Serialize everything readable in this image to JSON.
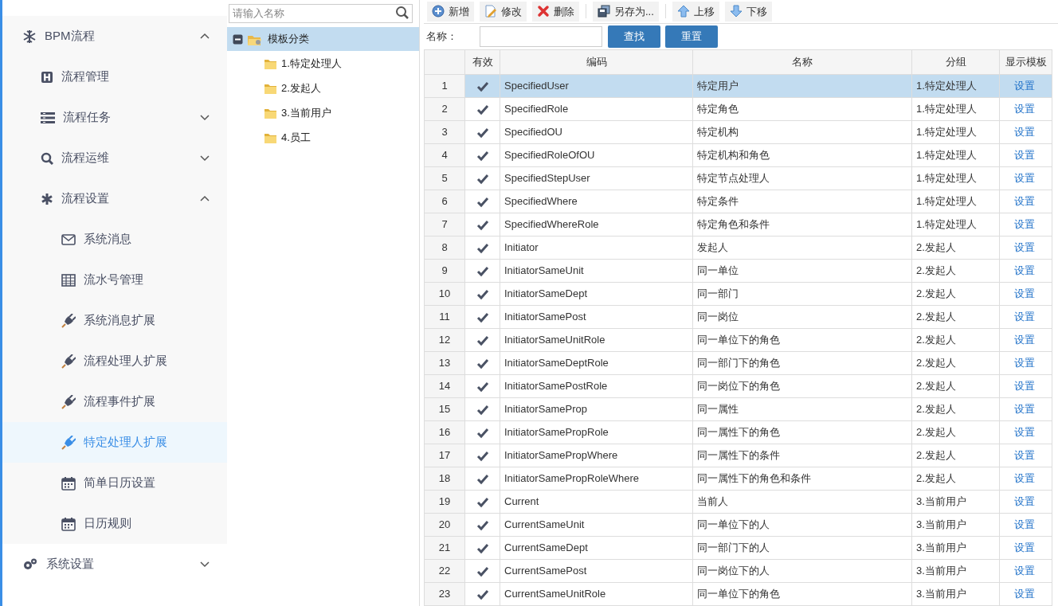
{
  "sidebar": {
    "items": [
      {
        "label": "BPM流程",
        "kind": "snowflake",
        "expanded": true,
        "children": [
          {
            "label": "流程管理",
            "kind": "h-square",
            "selected": false
          },
          {
            "label": "流程任务",
            "kind": "list",
            "expanded": false,
            "selected": false
          },
          {
            "label": "流程运维",
            "kind": "search",
            "expanded": false,
            "selected": false
          },
          {
            "label": "流程设置",
            "kind": "asterisk",
            "expanded": true,
            "selected": false,
            "children": [
              {
                "label": "系统消息",
                "kind": "envelope",
                "selected": false
              },
              {
                "label": "流水号管理",
                "kind": "table",
                "selected": false
              },
              {
                "label": "系统消息扩展",
                "kind": "plug",
                "selected": false
              },
              {
                "label": "流程处理人扩展",
                "kind": "plug",
                "selected": false
              },
              {
                "label": "流程事件扩展",
                "kind": "plug",
                "selected": false
              },
              {
                "label": "特定处理人扩展",
                "kind": "plug",
                "selected": true
              },
              {
                "label": "简单日历设置",
                "kind": "calendar",
                "selected": false
              },
              {
                "label": "日历规则",
                "kind": "calendar",
                "selected": false
              }
            ]
          }
        ]
      },
      {
        "label": "系统设置",
        "kind": "cogs",
        "expanded": false
      }
    ]
  },
  "tree": {
    "search": {
      "placeholder": "请输入名称"
    },
    "root": {
      "label": "模板分类",
      "expanded": true,
      "selected": true,
      "children": [
        {
          "label": "1.特定处理人",
          "selected": false
        },
        {
          "label": "2.发起人",
          "selected": false
        },
        {
          "label": "3.当前用户",
          "selected": false
        },
        {
          "label": "4.员工",
          "selected": false
        }
      ]
    }
  },
  "toolbar": [
    {
      "label": "新增",
      "kind": "add"
    },
    {
      "label": "修改",
      "kind": "edit"
    },
    {
      "label": "删除",
      "kind": "delete"
    },
    {
      "label": "另存为...",
      "kind": "saveas"
    },
    {
      "label": "上移",
      "kind": "up"
    },
    {
      "label": "下移",
      "kind": "down"
    }
  ],
  "filter": {
    "label": "名称：",
    "buttons": [
      "查找",
      "重置"
    ]
  },
  "table": {
    "columns": [
      "有效",
      "编码",
      "名称",
      "分组",
      "显示模板"
    ],
    "rows": [
      {
        "index": "1",
        "valid": true,
        "code": "SpecifiedUser",
        "name": "特定用户",
        "group": "1.特定处理人",
        "link": "设置",
        "selected": true
      },
      {
        "index": "2",
        "valid": true,
        "code": "SpecifiedRole",
        "name": "特定角色",
        "group": "1.特定处理人",
        "link": "设置",
        "selected": false
      },
      {
        "index": "3",
        "valid": true,
        "code": "SpecifiedOU",
        "name": "特定机构",
        "group": "1.特定处理人",
        "link": "设置",
        "selected": false
      },
      {
        "index": "4",
        "valid": true,
        "code": "SpecifiedRoleOfOU",
        "name": "特定机构和角色",
        "group": "1.特定处理人",
        "link": "设置",
        "selected": false
      },
      {
        "index": "5",
        "valid": true,
        "code": "SpecifiedStepUser",
        "name": "特定节点处理人",
        "group": "1.特定处理人",
        "link": "设置",
        "selected": false
      },
      {
        "index": "6",
        "valid": true,
        "code": "SpecifiedWhere",
        "name": "特定条件",
        "group": "1.特定处理人",
        "link": "设置",
        "selected": false
      },
      {
        "index": "7",
        "valid": true,
        "code": "SpecifiedWhereRole",
        "name": "特定角色和条件",
        "group": "1.特定处理人",
        "link": "设置",
        "selected": false
      },
      {
        "index": "8",
        "valid": true,
        "code": "Initiator",
        "name": "发起人",
        "group": "2.发起人",
        "link": "设置",
        "selected": false
      },
      {
        "index": "9",
        "valid": true,
        "code": "InitiatorSameUnit",
        "name": "同一单位",
        "group": "2.发起人",
        "link": "设置",
        "selected": false
      },
      {
        "index": "10",
        "valid": true,
        "code": "InitiatorSameDept",
        "name": "同一部门",
        "group": "2.发起人",
        "link": "设置",
        "selected": false
      },
      {
        "index": "11",
        "valid": true,
        "code": "InitiatorSamePost",
        "name": "同一岗位",
        "group": "2.发起人",
        "link": "设置",
        "selected": false
      },
      {
        "index": "12",
        "valid": true,
        "code": "InitiatorSameUnitRole",
        "name": "同一单位下的角色",
        "group": "2.发起人",
        "link": "设置",
        "selected": false
      },
      {
        "index": "13",
        "valid": true,
        "code": "InitiatorSameDeptRole",
        "name": "同一部门下的角色",
        "group": "2.发起人",
        "link": "设置",
        "selected": false
      },
      {
        "index": "14",
        "valid": true,
        "code": "InitiatorSamePostRole",
        "name": "同一岗位下的角色",
        "group": "2.发起人",
        "link": "设置",
        "selected": false
      },
      {
        "index": "15",
        "valid": true,
        "code": "InitiatorSameProp",
        "name": "同一属性",
        "group": "2.发起人",
        "link": "设置",
        "selected": false
      },
      {
        "index": "16",
        "valid": true,
        "code": "InitiatorSamePropRole",
        "name": "同一属性下的角色",
        "group": "2.发起人",
        "link": "设置",
        "selected": false
      },
      {
        "index": "17",
        "valid": true,
        "code": "InitiatorSamePropWhere",
        "name": "同一属性下的条件",
        "group": "2.发起人",
        "link": "设置",
        "selected": false
      },
      {
        "index": "18",
        "valid": true,
        "code": "InitiatorSamePropRoleWhere",
        "name": "同一属性下的角色和条件",
        "group": "2.发起人",
        "link": "设置",
        "selected": false
      },
      {
        "index": "19",
        "valid": true,
        "code": "Current",
        "name": "当前人",
        "group": "3.当前用户",
        "link": "设置",
        "selected": false
      },
      {
        "index": "20",
        "valid": true,
        "code": "CurrentSameUnit",
        "name": "同一单位下的人",
        "group": "3.当前用户",
        "link": "设置",
        "selected": false
      },
      {
        "index": "21",
        "valid": true,
        "code": "CurrentSameDept",
        "name": "同一部门下的人",
        "group": "3.当前用户",
        "link": "设置",
        "selected": false
      },
      {
        "index": "22",
        "valid": true,
        "code": "CurrentSamePost",
        "name": "同一岗位下的人",
        "group": "3.当前用户",
        "link": "设置",
        "selected": false
      },
      {
        "index": "23",
        "valid": true,
        "code": "CurrentSameUnitRole",
        "name": "同一单位下的角色",
        "group": "3.当前用户",
        "link": "设置",
        "selected": false
      }
    ]
  }
}
